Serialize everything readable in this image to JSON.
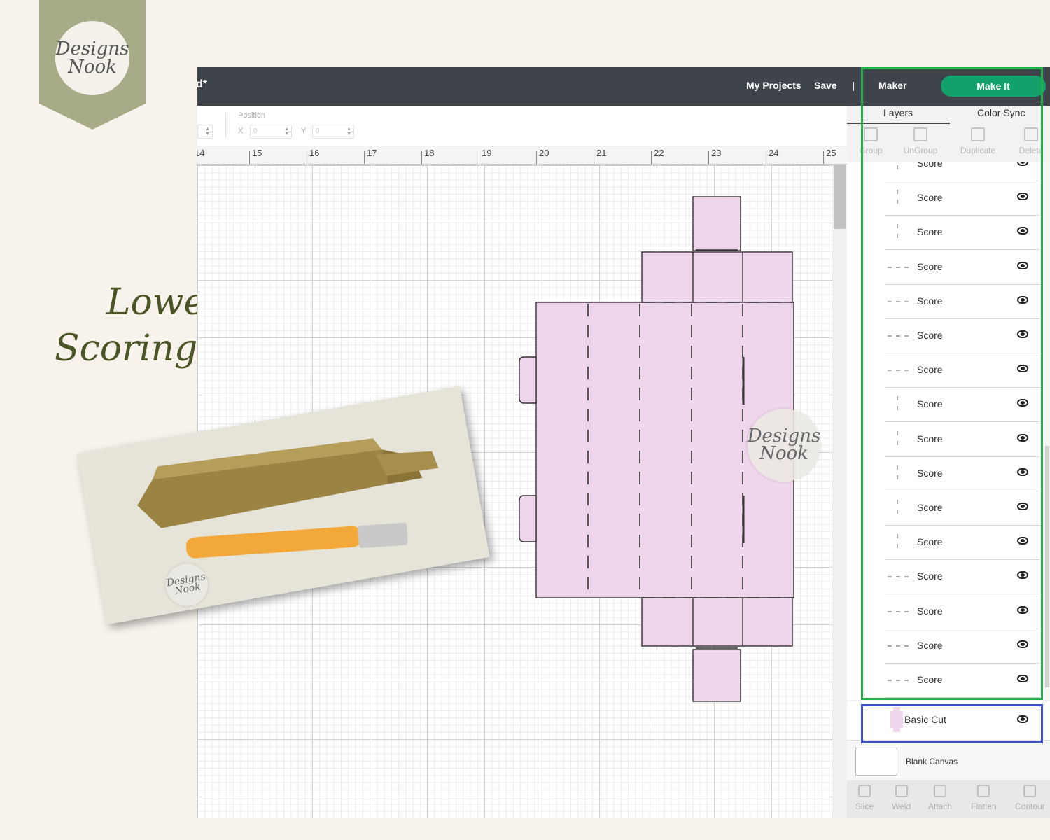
{
  "brand": {
    "line1": "Designs",
    "line2": "Nook"
  },
  "side_title": {
    "line1": "Lower",
    "line2": "Scoring View"
  },
  "topbar": {
    "project_fragment": "d*",
    "my_projects": "My Projects",
    "save": "Save",
    "separator": "|",
    "machine": "Maker",
    "make_it": "Make It"
  },
  "toolbar": {
    "position_label": "Position",
    "x_label": "X",
    "y_label": "Y",
    "x_value": "0",
    "y_value": "0"
  },
  "ruler": {
    "labels": [
      "14",
      "15",
      "16",
      "17",
      "18",
      "19",
      "20",
      "21",
      "22",
      "23",
      "24",
      "25"
    ]
  },
  "panel": {
    "tabs": {
      "layers": "Layers",
      "color_sync": "Color Sync"
    },
    "tools": {
      "group": "Group",
      "ungroup": "UnGroup",
      "duplicate": "Duplicate",
      "delete": "Delete"
    },
    "layers": [
      {
        "label": "Score",
        "thumb": "vertical"
      },
      {
        "label": "Score",
        "thumb": "vertical"
      },
      {
        "label": "Score",
        "thumb": "vertical"
      },
      {
        "label": "Score",
        "thumb": "horizontal"
      },
      {
        "label": "Score",
        "thumb": "horizontal"
      },
      {
        "label": "Score",
        "thumb": "horizontal"
      },
      {
        "label": "Score",
        "thumb": "horizontal"
      },
      {
        "label": "Score",
        "thumb": "vertical"
      },
      {
        "label": "Score",
        "thumb": "vertical"
      },
      {
        "label": "Score",
        "thumb": "vertical"
      },
      {
        "label": "Score",
        "thumb": "vertical"
      },
      {
        "label": "Score",
        "thumb": "vertical"
      },
      {
        "label": "Score",
        "thumb": "horizontal"
      },
      {
        "label": "Score",
        "thumb": "horizontal"
      },
      {
        "label": "Score",
        "thumb": "horizontal"
      },
      {
        "label": "Score",
        "thumb": "horizontal"
      }
    ],
    "basic_cut": "Basic Cut",
    "blank_canvas": "Blank Canvas",
    "bottom_tools": {
      "slice": "Slice",
      "weld": "Weld",
      "attach": "Attach",
      "flatten": "Flatten",
      "contour": "Contour"
    }
  },
  "colors": {
    "topbar": "#3f434a",
    "make_it": "#12a16b",
    "dieline_fill": "#f0d6ec",
    "highlight_green": "#22b04a",
    "highlight_blue": "#3c4fc4",
    "banner": "#a7ab87",
    "title": "#4b5425"
  }
}
